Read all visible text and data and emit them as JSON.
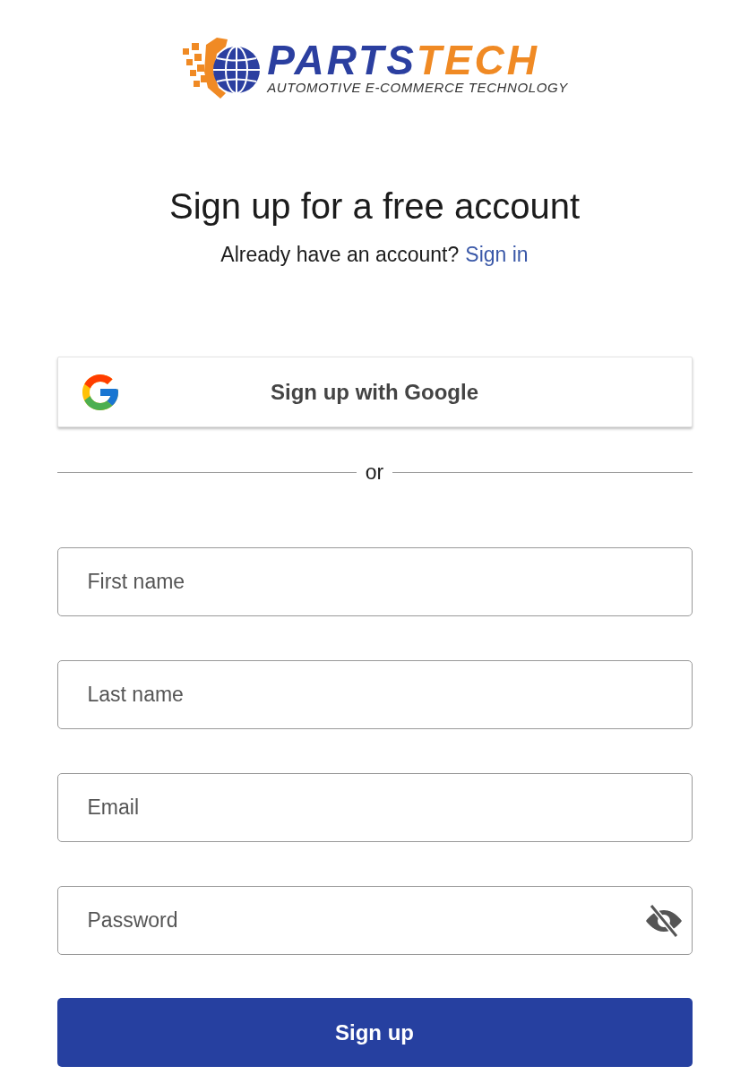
{
  "logo": {
    "brand_part_1": "PARTS",
    "brand_part_2": "TECH",
    "tagline": "AUTOMOTIVE E-COMMERCE TECHNOLOGY"
  },
  "heading": "Sign up for a free account",
  "signin_prompt": {
    "text": "Already have an account?",
    "link": "Sign in"
  },
  "google_button": "Sign up with Google",
  "divider": "or",
  "fields": [
    {
      "kind": "text",
      "placeholder": "First name"
    },
    {
      "kind": "text",
      "placeholder": "Last name"
    },
    {
      "kind": "text",
      "placeholder": "Email"
    },
    {
      "kind": "password",
      "placeholder": "Password",
      "password_visible": false
    }
  ],
  "submit_button": "Sign up"
}
